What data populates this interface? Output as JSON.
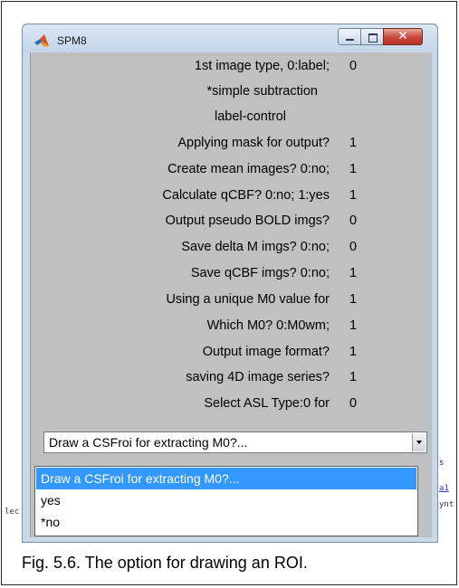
{
  "window": {
    "title": "SPM8"
  },
  "colors": {
    "selected_bg": "#3399ff",
    "panel_bg": "#c0c0c0",
    "close_button": "#c8463a"
  },
  "header_rows": [
    {
      "label": "1st image type, 0:label;",
      "value": "0"
    },
    {
      "label": "*simple subtraction"
    },
    {
      "label": "label-control"
    }
  ],
  "options": [
    {
      "label": "Applying mask for output?",
      "value": "1"
    },
    {
      "label": "Create mean images? 0:no;",
      "value": "1"
    },
    {
      "label": "Calculate qCBF? 0:no; 1:yes",
      "value": "1"
    },
    {
      "label": "Output pseudo BOLD imgs?",
      "value": "0"
    },
    {
      "label": "Save delta M imgs? 0:no;",
      "value": "0"
    },
    {
      "label": "Save qCBF imgs? 0:no;",
      "value": "1"
    },
    {
      "label": "Using a unique M0 value for",
      "value": "1"
    },
    {
      "label": "Which M0? 0:M0wm;",
      "value": "1"
    },
    {
      "label": "Output image format?",
      "value": "1"
    },
    {
      "label": "saving 4D image series?",
      "value": "1"
    },
    {
      "label": "Select ASL Type:0 for",
      "value": "0"
    }
  ],
  "dropdown": {
    "value": "Draw a CSFroi for extracting M0?...",
    "items": [
      "Draw a CSFroi for extracting M0?...",
      "yes",
      "*no"
    ]
  },
  "background_fragments": [
    "lec",
    "s",
    "a1",
    "ynt"
  ],
  "caption": "Fig. 5.6. The option for drawing an ROI."
}
